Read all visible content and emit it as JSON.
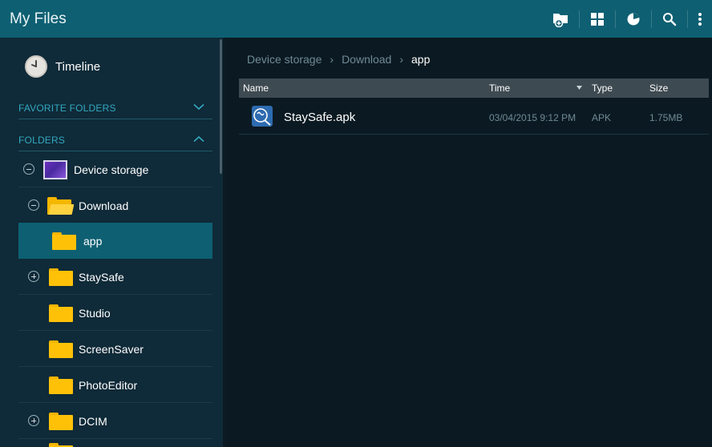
{
  "actionbar": {
    "title": "My Files",
    "icons": [
      "add-folder-icon",
      "grid-view-icon",
      "storage-usage-icon",
      "search-icon",
      "more-options-icon"
    ]
  },
  "sidebar": {
    "timeline_label": "Timeline",
    "favorites_label": "FAVORITE FOLDERS",
    "folders_label": "FOLDERS",
    "tree": [
      {
        "label": "Device storage",
        "expander": "collapse"
      },
      {
        "label": "Download",
        "expander": "collapse"
      },
      {
        "label": "app",
        "selected": true
      },
      {
        "label": "StaySafe",
        "expander": "expand"
      },
      {
        "label": "Studio"
      },
      {
        "label": "ScreenSaver"
      },
      {
        "label": "PhotoEditor"
      },
      {
        "label": "DCIM",
        "expander": "expand"
      }
    ]
  },
  "breadcrumb": {
    "items": [
      "Device storage",
      "Download",
      "app"
    ],
    "separator": "›"
  },
  "table": {
    "columns": {
      "name": "Name",
      "time": "Time",
      "type": "Type",
      "size": "Size"
    },
    "rows": [
      {
        "name": "StaySafe.apk",
        "time": "03/04/2015 9:12 PM",
        "type": "APK",
        "size": "1.75MB"
      }
    ]
  },
  "colors": {
    "actionbar": "#0e5f72",
    "sidebar": "#0f2a38",
    "selected": "#0e5f72",
    "section_label": "#33a8c0",
    "folder": "#ffc107"
  }
}
